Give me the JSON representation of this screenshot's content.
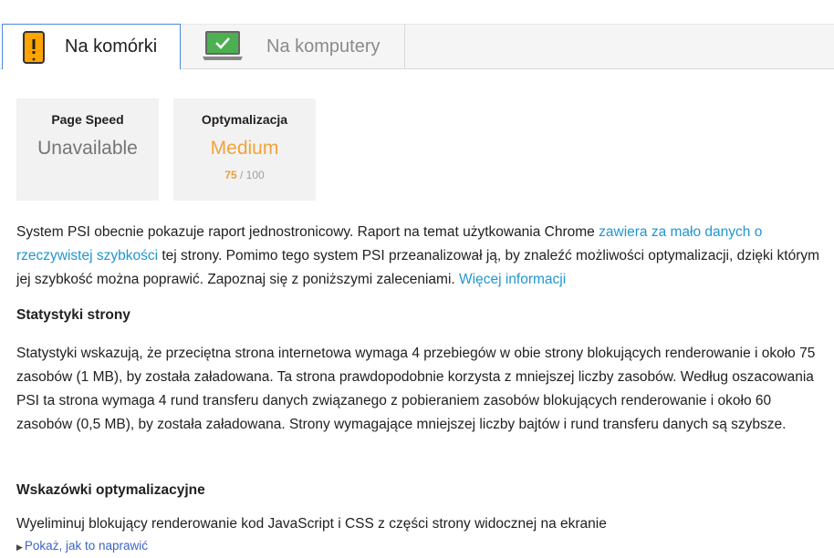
{
  "tabs": [
    {
      "label": "Na komórki",
      "icon": "mobile-warning-icon",
      "active": true
    },
    {
      "label": "Na komputery",
      "icon": "desktop-check-icon",
      "active": false
    }
  ],
  "cards": [
    {
      "title": "Page Speed",
      "value": "Unavailable"
    },
    {
      "title": "Optymalizacja",
      "value": "Medium",
      "score": "75",
      "score_max": " / 100"
    }
  ],
  "intro": {
    "text1": "System PSI obecnie pokazuje raport jednostronicowy. Raport na temat użytkowania Chrome ",
    "link1": "zawiera za mało danych o rzeczywistej szybkości",
    "text2": " tej strony. Pomimo tego system PSI przeanalizował ją, by znaleźć możliwości optymalizacji, dzięki którym jej szybkość można poprawić. Zapoznaj się z poniższymi zaleceniami. ",
    "link2": "Więcej informacji"
  },
  "stats": {
    "heading": "Statystyki strony",
    "body": "Statystyki wskazują, że przeciętna strona internetowa wymaga 4 przebiegów w obie strony blokujących renderowanie i około 75 zasobów (1 MB), by została załadowana. Ta strona prawdopodobnie korzysta z mniejszej liczby zasobów. Według oszacowania PSI ta strona wymaga 4 rund transferu danych związanego z pobieraniem zasobów blokujących renderowanie i około 60 zasobów (0,5 MB), by została załadowana. Strony wymagające mniejszej liczby bajtów i rund transferu danych są szybsze."
  },
  "tips": {
    "heading": "Wskazówki optymalizacyjne",
    "item": "Wyeliminuj blokujący renderowanie kod JavaScript i CSS z części strony widocznej na ekranie",
    "fix_link": "Pokaż, jak to naprawić"
  },
  "colors": {
    "accent": "#4a89dc",
    "warning": "#f0a43a",
    "link": "#2196d1"
  }
}
